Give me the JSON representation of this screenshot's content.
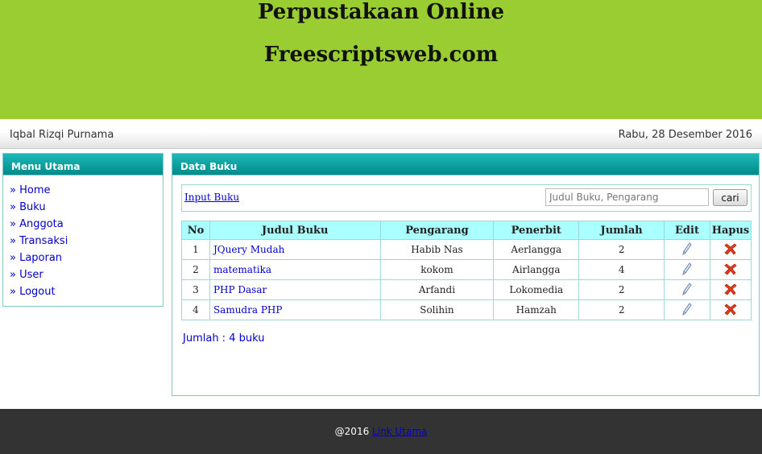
{
  "header": {
    "title": "Perpustakaan Online",
    "subtitle": "Freescriptsweb.com",
    "bg_color": "#9acd32"
  },
  "userbar": {
    "user_name": "Iqbal Rizqi Purnama",
    "date": "Rabu, 28 Desember 2016"
  },
  "menu": {
    "title": "Menu Utama",
    "items": [
      {
        "label": "» Home"
      },
      {
        "label": "» Buku"
      },
      {
        "label": "» Anggota"
      },
      {
        "label": "» Transaksi"
      },
      {
        "label": "» Laporan"
      },
      {
        "label": "» User"
      },
      {
        "label": "» Logout"
      }
    ]
  },
  "main": {
    "title": "Data Buku",
    "input_link": "Input Buku",
    "search_placeholder": "Judul Buku, Pengarang",
    "search_value": "",
    "search_button": "cari",
    "table": {
      "headers": [
        "No",
        "Judul Buku",
        "Pengarang",
        "Penerbit",
        "Jumlah",
        "Edit",
        "Hapus"
      ],
      "rows": [
        {
          "no": "1",
          "judul": "JQuery Mudah",
          "pengarang": "Habib Nas",
          "penerbit": "Aerlangga",
          "jumlah": "2",
          "edit_icon": "pencil-icon",
          "hapus_icon": "delete-x-icon"
        },
        {
          "no": "2",
          "judul": "matematika",
          "pengarang": "kokom",
          "penerbit": "Airlangga",
          "jumlah": "4",
          "edit_icon": "pencil-icon",
          "hapus_icon": "delete-x-icon"
        },
        {
          "no": "3",
          "judul": "PHP Dasar",
          "pengarang": "Arfandi",
          "penerbit": "Lokomedia",
          "jumlah": "2",
          "edit_icon": "pencil-icon",
          "hapus_icon": "delete-x-icon"
        },
        {
          "no": "4",
          "judul": "Samudra PHP",
          "pengarang": "Solihin",
          "penerbit": "Hamzah",
          "jumlah": "2",
          "edit_icon": "pencil-icon",
          "hapus_icon": "delete-x-icon"
        }
      ]
    },
    "total_text": "Jumlah : 4 buku"
  },
  "footer": {
    "copyright": "@2016",
    "link_label": "Link Utama",
    "bg_color": "#333333"
  },
  "colors": {
    "accent_teal": "#008b8b",
    "table_header": "#aaffff",
    "link": "#0000cc",
    "delete": "#e03c1e"
  }
}
